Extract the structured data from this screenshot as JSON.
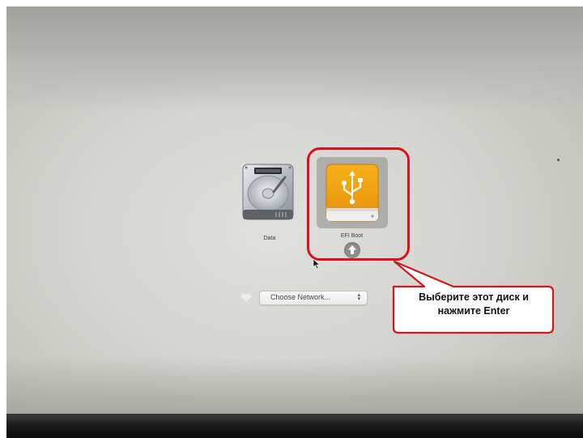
{
  "disks": [
    {
      "label": "Data",
      "icon": "hard-drive-icon",
      "selected": false
    },
    {
      "label": "EFI Boot",
      "icon": "usb-drive-icon",
      "selected": true
    }
  ],
  "network": {
    "selected": "Choose Network...",
    "icon": "wifi-icon"
  },
  "callout": {
    "line1": "Выберите этот диск и",
    "line2": "нажмите Enter"
  },
  "colors": {
    "highlight": "#e0101a",
    "usb_orange": "#f0a010",
    "background": "#d6d6d2"
  }
}
